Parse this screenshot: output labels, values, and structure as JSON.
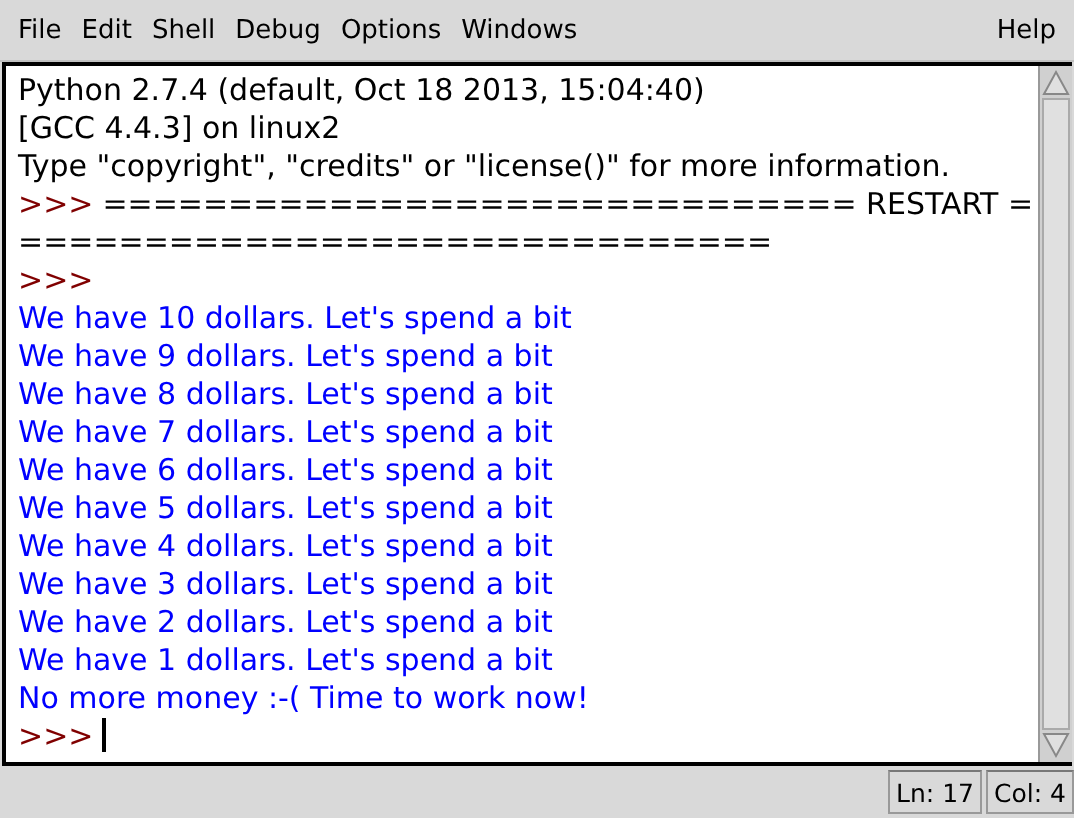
{
  "menu": [
    {
      "label": "File"
    },
    {
      "label": "Edit"
    },
    {
      "label": "Shell"
    },
    {
      "label": "Debug"
    },
    {
      "label": "Options"
    },
    {
      "label": "Windows"
    },
    {
      "label": "Help"
    }
  ],
  "shell_lines": [
    [
      {
        "kind": "stdout",
        "text": "Python 2.7.4 (default, Oct 18 2013, 15:04:40)"
      }
    ],
    [
      {
        "kind": "stdout",
        "text": "[GCC 4.4.3] on linux2"
      }
    ],
    [
      {
        "kind": "stdout",
        "text": "Type \"copyright\", \"credits\" or \"license()\" for more information."
      }
    ],
    [
      {
        "kind": "prompt",
        "text": ">>>"
      },
      {
        "kind": "stdout",
        "text": "============================== RESTART ="
      }
    ],
    [
      {
        "kind": "stdout",
        "text": "=============================="
      }
    ],
    [
      {
        "kind": "prompt",
        "text": ">>>"
      }
    ],
    [
      {
        "kind": "output",
        "text": "We have 10 dollars. Let's spend a bit"
      }
    ],
    [
      {
        "kind": "output",
        "text": "We have 9 dollars. Let's spend a bit"
      }
    ],
    [
      {
        "kind": "output",
        "text": "We have 8 dollars. Let's spend a bit"
      }
    ],
    [
      {
        "kind": "output",
        "text": "We have 7 dollars. Let's spend a bit"
      }
    ],
    [
      {
        "kind": "output",
        "text": "We have 6 dollars. Let's spend a bit"
      }
    ],
    [
      {
        "kind": "output",
        "text": "We have 5 dollars. Let's spend a bit"
      }
    ],
    [
      {
        "kind": "output",
        "text": "We have 4 dollars. Let's spend a bit"
      }
    ],
    [
      {
        "kind": "output",
        "text": "We have 3 dollars. Let's spend a bit"
      }
    ],
    [
      {
        "kind": "output",
        "text": "We have 2 dollars. Let's spend a bit"
      }
    ],
    [
      {
        "kind": "output",
        "text": "We have 1 dollars. Let's spend a bit"
      }
    ],
    [
      {
        "kind": "output",
        "text": "No more money :-( Time to work now!"
      }
    ],
    [
      {
        "kind": "prompt",
        "text": ">>>"
      },
      {
        "kind": "cursor"
      }
    ]
  ],
  "status_bar": [
    {
      "text": "Ln: 17"
    },
    {
      "text": "Col: 4"
    }
  ]
}
